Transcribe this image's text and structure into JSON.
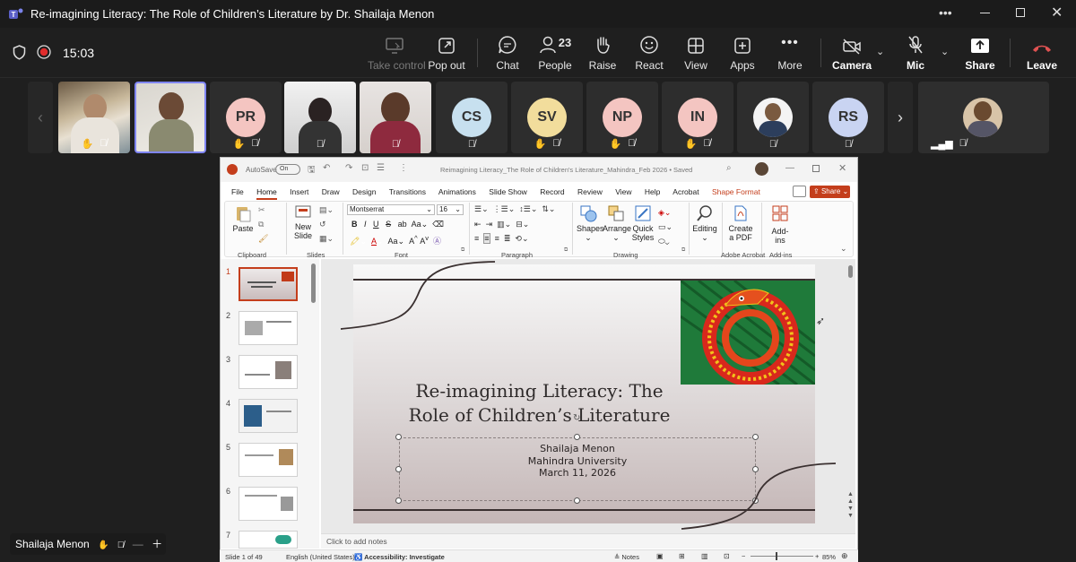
{
  "window": {
    "title": "Re-imagining Literacy: The Role of Children’s Literature by Dr. Shailaja Menon"
  },
  "meeting": {
    "timer": "15:03"
  },
  "toolbar": {
    "take_control": "Take control",
    "pop_out": "Pop out",
    "chat": "Chat",
    "people": "People",
    "people_count": "23",
    "raise": "Raise",
    "react": "React",
    "view": "View",
    "apps": "Apps",
    "more": "More",
    "camera": "Camera",
    "mic": "Mic",
    "share": "Share",
    "leave": "Leave"
  },
  "participants": [
    {
      "initials": ""
    },
    {
      "initials": ""
    },
    {
      "initials": "PR",
      "color": "#f4c5c1"
    },
    {
      "initials": ""
    },
    {
      "initials": ""
    },
    {
      "initials": "CS",
      "color": "#c7e0ef"
    },
    {
      "initials": "SV",
      "color": "#f2dd9c"
    },
    {
      "initials": "NP",
      "color": "#f4c5c1"
    },
    {
      "initials": "IN",
      "color": "#f4c5c1"
    },
    {
      "initials": ""
    },
    {
      "initials": "RS",
      "color": "#c9d4f2"
    }
  ],
  "presenter_label": "Shailaja Menon",
  "ppt": {
    "autosave": "AutoSave",
    "autosave_state": "On",
    "filename": "Reimagining Literacy_The Role of Children's Literature_Mahindra_Feb 2026 • Saved",
    "menus": [
      "File",
      "Home",
      "Insert",
      "Draw",
      "Design",
      "Transitions",
      "Animations",
      "Slide Show",
      "Record",
      "Review",
      "View",
      "Help",
      "Acrobat"
    ],
    "shape_format": "Shape Format",
    "share": "Share",
    "ribbon": {
      "paste": "Paste",
      "clipboard": "Clipboard",
      "new_slide": "New",
      "new_slide2": "Slide",
      "slides": "Slides",
      "font_name": "Montserrat",
      "font_size": "16",
      "font": "Font",
      "paragraph": "Paragraph",
      "shapes": "Shapes",
      "arrange": "Arrange",
      "quick_styles": "Quick",
      "quick_styles2": "Styles",
      "drawing": "Drawing",
      "editing": "Editing",
      "create_pdf": "Create",
      "create_pdf2": "a PDF",
      "adobe_acrobat": "Adobe Acrobat",
      "add_ins": "Add-ins",
      "add_ins_group": "Add-ins"
    },
    "thumb_numbers": [
      "1",
      "2",
      "3",
      "4",
      "5",
      "6",
      "7"
    ],
    "slide": {
      "title_line1": "Re-imagining Literacy: The",
      "title_line2": "Role of Children’s Literature",
      "sub1": "Shailaja Menon",
      "sub2": "Mahindra University",
      "sub3": "March 11, 2026"
    },
    "notes_placeholder": "Click to add notes",
    "status": {
      "slide_of": "Slide 1 of 49",
      "language": "English (United States)",
      "accessibility": "Accessibility: Investigate",
      "notes": "Notes",
      "zoom": "85%"
    }
  }
}
